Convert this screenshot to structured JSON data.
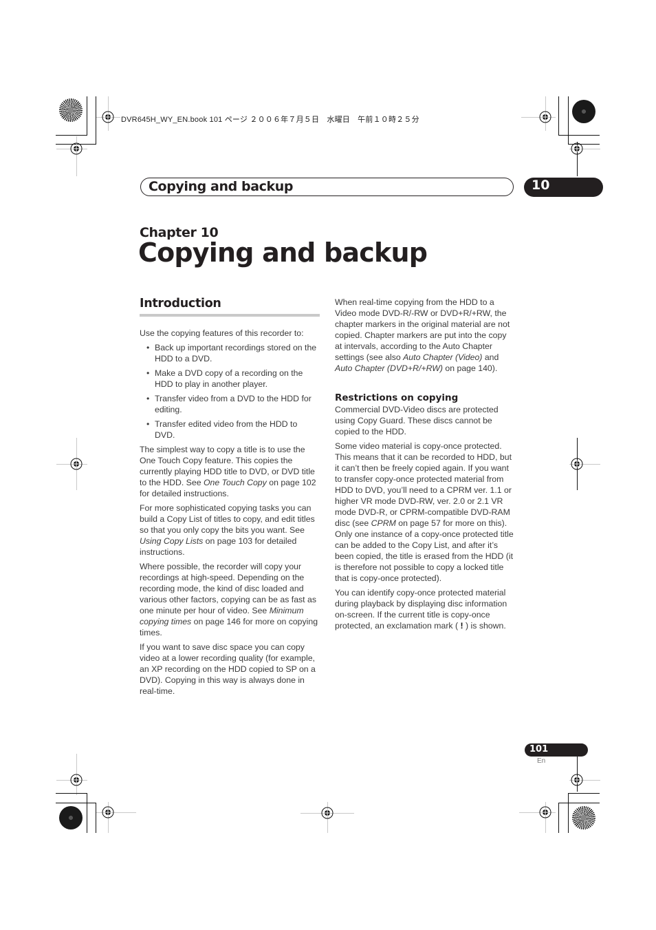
{
  "slug": {
    "text": "DVR645H_WY_EN.book  101 ページ  ２００６年７月５日　水曜日　午前１０時２５分"
  },
  "header": {
    "section_title": "Copying and backup",
    "chapter_number": "10"
  },
  "chapter": {
    "label": "Chapter 10",
    "title": "Copying and backup"
  },
  "left_column": {
    "heading": "Introduction",
    "intro": "Use the copying features of this recorder to:",
    "bullets": [
      "Back up important recordings stored on the HDD to a DVD.",
      "Make a DVD copy of a recording on the HDD to play in another player.",
      "Transfer video from a DVD to the HDD for editing.",
      "Transfer edited video from the HDD to DVD."
    ],
    "bullet_glyph": "•",
    "p1": {
      "a": "The simplest way to copy a title is to use the One Touch Copy feature. This copies the currently playing HDD title to DVD, or DVD title to the HDD. See ",
      "ref": "One Touch Copy",
      "b": " on page 102 for detailed instructions."
    },
    "p2": {
      "a": "For more sophisticated copying tasks you can build a Copy List of titles to copy, and edit titles so that you only copy the bits you want. See ",
      "ref": "Using Copy Lists",
      "b": " on page 103 for detailed instructions."
    },
    "p3": {
      "a": "Where possible, the recorder will copy your recordings at high-speed. Depending on the recording mode, the kind of disc loaded and various other factors, copying can be as fast as one minute per hour of video. See ",
      "ref": "Minimum copying times",
      "b": " on page 146 for more on copying times."
    },
    "p4": "If you want to save disc space you can copy video at a lower recording quality (for example, an XP recording on the HDD copied to SP on a DVD). Copying in this way is always done in real-time."
  },
  "right_column": {
    "p1": {
      "a": "When real-time copying from the HDD to a Video mode DVD-R/-RW or DVD+R/+RW, the chapter markers in the original material are not copied. Chapter markers are put into the copy at intervals, according to the Auto Chapter settings (see also ",
      "ref1": "Auto Chapter (Video)",
      "mid": " and ",
      "ref2": "Auto Chapter (DVD+R/+RW)",
      "b": " on page 140)."
    },
    "subheading": "Restrictions on copying",
    "p2": "Commercial DVD-Video discs are protected using Copy Guard. These discs cannot be copied to the HDD.",
    "p3": {
      "a": "Some video material is copy-once protected. This means that it can be recorded to HDD, but it can’t then be freely copied again. If you want to transfer copy-once protected material from HDD to DVD, you’ll need to a CPRM ver. 1.1 or higher VR mode DVD-RW, ver. 2.0 or 2.1 VR mode DVD-R, or CPRM-compatible DVD-RAM disc (see ",
      "ref": "CPRM",
      "b": " on page 57 for more on this). Only one instance of a copy-once protected title can be added to the Copy List, and after it’s been copied, the title is erased from the HDD (it is therefore not possible to copy a locked title that is copy-once protected)."
    },
    "p4": {
      "a": "You can identify copy-once protected material during playback by displaying disc information on-screen. If the current title is copy-once protected, an exclamation mark (",
      "mark": " ! ",
      "b": ") is shown."
    }
  },
  "footer": {
    "page_number": "101",
    "language": "En"
  }
}
